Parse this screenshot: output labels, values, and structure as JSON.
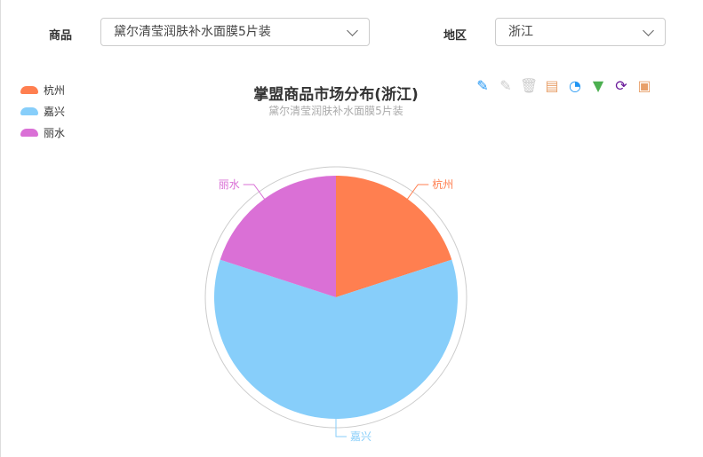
{
  "filters": {
    "product_label": "商品",
    "product_value": "黛尔清莹润肤补水面膜5片装",
    "region_label": "地区",
    "region_value": "浙江"
  },
  "toolbar": [
    {
      "icon": "pencil-plus-icon",
      "glyph": "✎",
      "color": "#2196f3"
    },
    {
      "icon": "pencil-minus-icon",
      "glyph": "✎",
      "color": "#ccc"
    },
    {
      "icon": "trash-icon",
      "glyph": "🗑",
      "color": "#ccc"
    },
    {
      "icon": "data-view-icon",
      "glyph": "▤",
      "color": "#e8a06a"
    },
    {
      "icon": "pie-chart-icon",
      "glyph": "◔",
      "color": "#2196f3"
    },
    {
      "icon": "funnel-icon",
      "glyph": "▼",
      "color": "#4caf50"
    },
    {
      "icon": "refresh-icon",
      "glyph": "⟳",
      "color": "#6a1b9a"
    },
    {
      "icon": "save-icon",
      "glyph": "▣",
      "color": "#e8a06a"
    }
  ],
  "chart_data": {
    "type": "pie",
    "title": "掌盟商品市场分布(浙江)",
    "subtitle": "黛尔清莹润肤补水面膜5片装",
    "legend_position": "top-left",
    "slices": [
      {
        "name": "杭州",
        "value": 1,
        "color": "#ff7f50"
      },
      {
        "name": "嘉兴",
        "value": 3,
        "color": "#87cefa"
      },
      {
        "name": "丽水",
        "value": 1,
        "color": "#da70d6"
      }
    ]
  }
}
